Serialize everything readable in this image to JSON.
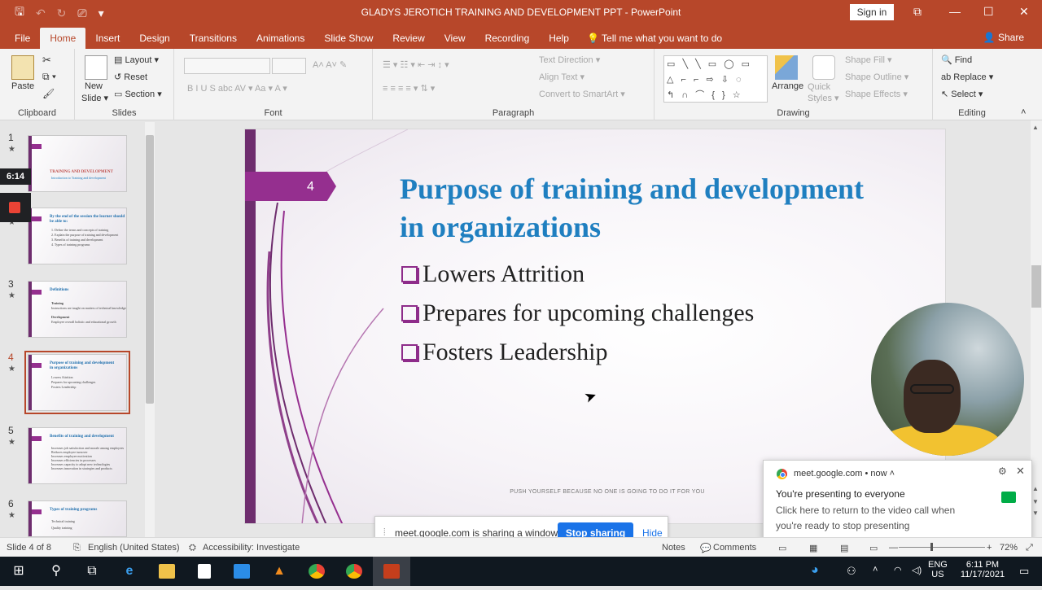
{
  "window": {
    "title": "GLADYS JEROTICH TRAINING AND DEVELOPMENT PPT  -  PowerPoint",
    "signin": "Sign in",
    "qat": {
      "save": "🖫",
      "undo": "↶",
      "redo": "↻",
      "present": "⎚",
      "more": "▾"
    },
    "controls": {
      "ribbon_display": "⧉",
      "minimize": "—",
      "maximize": "☐",
      "close": "✕"
    }
  },
  "ribbon": {
    "tabs": [
      "File",
      "Home",
      "Insert",
      "Design",
      "Transitions",
      "Animations",
      "Slide Show",
      "Review",
      "View",
      "Recording",
      "Help"
    ],
    "tell_me": "Tell me what you want to do",
    "share": "Share",
    "groups": {
      "clipboard": "Clipboard",
      "slides": "Slides",
      "font": "Font",
      "paragraph": "Paragraph",
      "drawing": "Drawing",
      "editing": "Editing"
    },
    "buttons": {
      "paste": "Paste",
      "new_slide_1": "New",
      "new_slide_2": "Slide ▾",
      "layout": "Layout ▾",
      "reset": "Reset",
      "section": "Section ▾",
      "font_format": "B   I   U   S  abc  AV ▾  Aa ▾     A ▾",
      "para_row1": "☰ ▾   ☷ ▾   ⇤   ⇥   ↕ ▾",
      "para_row2": "≡   ≡   ≡   ≡ ▾     ⇅ ▾",
      "text_direction": "Text Direction ▾",
      "align_text": "Align Text ▾",
      "convert_smartart": "Convert to SmartArt ▾",
      "shapes_row1": "▭ ╲ ╲ ▭ ◯ ▭",
      "shapes_row2": "△ ⌐ ⌐ ⇨ ⇩ ◌",
      "shapes_row3": "↰ ∩ ⌒ { } ☆",
      "arrange": "Arrange",
      "quick_styles": "Quick Styles ▾",
      "shape_fill": "Shape Fill ▾",
      "shape_outline": "Shape Outline ▾",
      "shape_effects": "Shape Effects ▾",
      "find": "Find",
      "replace": "Replace ▾",
      "select": "Select ▾"
    }
  },
  "thumbnails": [
    {
      "num": "1",
      "title": "TRAINING AND DEVELOPMENT",
      "lines": [
        "Introduction to Training and development"
      ]
    },
    {
      "num": "2",
      "title": "By the end of the session the learner should be able to:",
      "lines": [
        "1. Define the terms and concepts of training",
        "2. Explain the purpose of training and development",
        "3. Benefits of training and development",
        "4. Types of training programs"
      ]
    },
    {
      "num": "3",
      "title": "Definitions",
      "lines": [
        "Training",
        "Instructions are taught on matters of technical knowledge",
        "Development",
        "Employee overall holistic and educational growth"
      ]
    },
    {
      "num": "4",
      "title": "Purpose of training and development in organizations",
      "lines": [
        "Lowers Attrition",
        "Prepares for upcoming challenges",
        "Fosters Leadership"
      ]
    },
    {
      "num": "5",
      "title": "Benefits of training and development",
      "lines": [
        "Increases job satisfaction and morale among employees",
        "Reduces employee turnover",
        "Increases employee motivation",
        "Increases efficiencies in processes",
        "Increases capacity to adopt new technologies",
        "Increases innovation in strategies and products"
      ]
    },
    {
      "num": "6",
      "title": "Types of training programs",
      "lines": [
        "Technical training",
        "Quality training"
      ]
    }
  ],
  "presenter": {
    "timer": "6:14"
  },
  "slide": {
    "number": "4",
    "title": "Purpose of training and development in organizations",
    "bullets": [
      "Lowers Attrition",
      "Prepares for upcoming challenges",
      "Fosters Leadership"
    ],
    "footer": "PUSH YOURSELF BECAUSE NO ONE IS GOING TO DO IT FOR YOU"
  },
  "notification": {
    "source": "meet.google.com",
    "time": "• now ˄",
    "heading": "You're presenting to everyone",
    "body": "Click here to return to the video call when you're ready to stop presenting"
  },
  "sharebar": {
    "message": "meet.google.com is sharing a window.",
    "stop": "Stop sharing",
    "hide": "Hide"
  },
  "statusbar": {
    "slide_info": "Slide 4 of 8",
    "language": "English (United States)",
    "accessibility": "Accessibility: Investigate",
    "notes": "Notes",
    "comments": "Comments",
    "zoom": "72%"
  },
  "taskbar": {
    "lang1": "ENG",
    "lang2": "US",
    "time": "6:11 PM",
    "date": "11/17/2021"
  },
  "colors": {
    "accent": "#b7472a",
    "slide_title": "#1f7fc0",
    "slide_purple": "#952f8f",
    "stop_button": "#1a73e8"
  }
}
